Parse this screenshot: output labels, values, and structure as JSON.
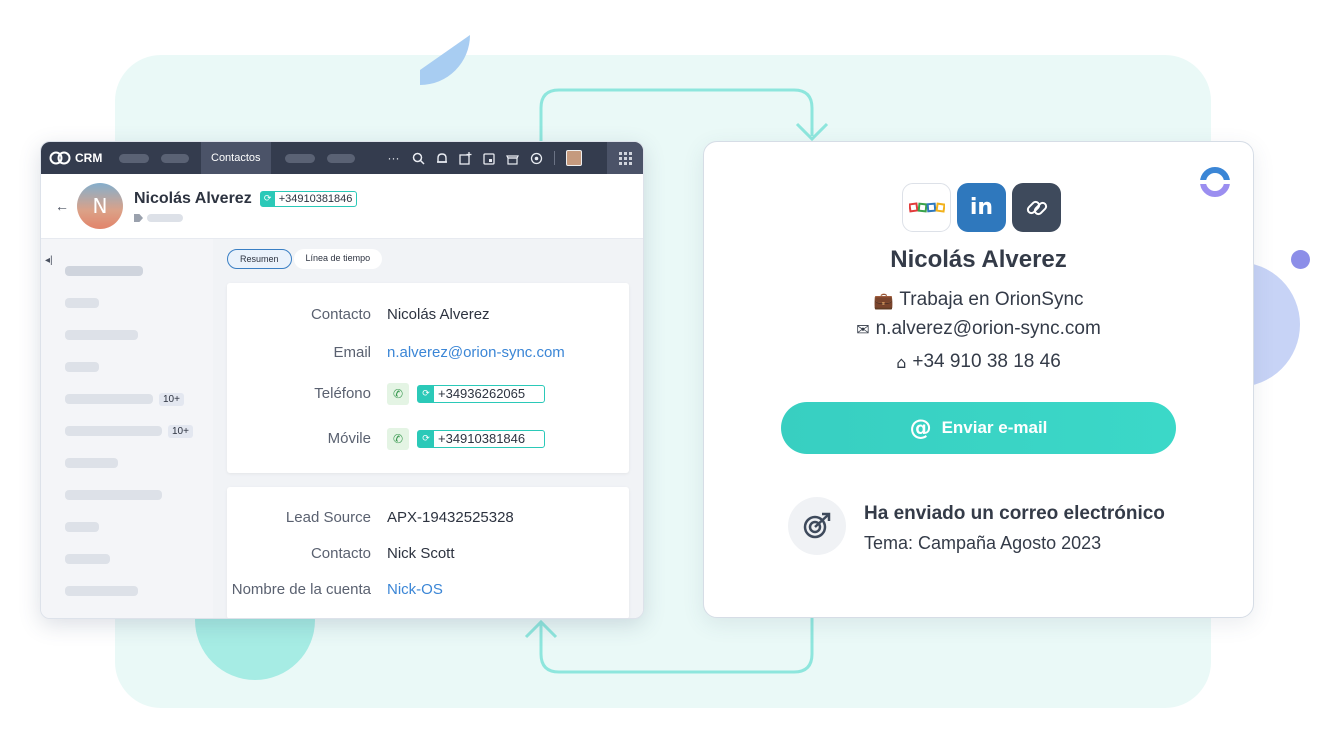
{
  "crm": {
    "logo_text": "CRM",
    "active_tab": "Contactos",
    "header": {
      "name": "Nicolás Alverez",
      "avatar_initial": "N",
      "phone_chip": "+34910381846"
    },
    "sidebar_badges": [
      "10+",
      "10+"
    ],
    "segments": {
      "summary": "Resumen",
      "timeline": "Línea de tiempo"
    },
    "details": [
      {
        "label": "Contacto",
        "value": "Nicolás Alverez"
      },
      {
        "label": "Email",
        "value": "n.alverez@orion-sync.com"
      },
      {
        "label": "Teléfono",
        "value": "+34936262065"
      },
      {
        "label": "Móvile",
        "value": "+34910381846"
      }
    ],
    "extra": [
      {
        "label": "Lead Source",
        "value": "APX-19432525328"
      },
      {
        "label": "Contacto",
        "value": "Nick Scott"
      },
      {
        "label": "Nombre de la cuenta",
        "value": "Nick-OS"
      }
    ]
  },
  "card": {
    "source_icons": [
      "zoho-icon",
      "linkedin-icon",
      "link-icon"
    ],
    "name": "Nicolás Alverez",
    "company": "Trabaja en OrionSync",
    "email": "n.alverez@orion-sync.com",
    "phone": "+34 910 38 18 46",
    "send_button": "Enviar e-mail",
    "activity_title": "Ha enviado un correo electrónico",
    "activity_subject": "Tema: Campaña Agosto 2023"
  },
  "colors": {
    "accent_teal": "#38cfc1",
    "crm_topbar": "#343c4e",
    "link_blue": "#3b86d6",
    "background_panel": "#eaf9f7"
  }
}
